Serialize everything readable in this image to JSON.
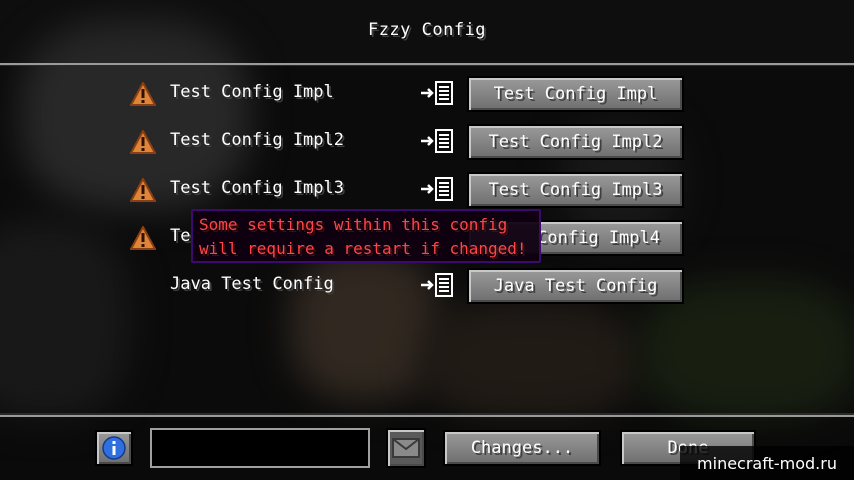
{
  "title": "Fzzy Config",
  "configs": [
    {
      "label": "Test Config Impl",
      "button": "Test Config Impl",
      "warning": true
    },
    {
      "label": "Test Config Impl2",
      "button": "Test Config Impl2",
      "warning": true
    },
    {
      "label": "Test Config Impl3",
      "button": "Test Config Impl3",
      "warning": true
    },
    {
      "label": "Te",
      "button": "Config Impl4",
      "warning": true
    },
    {
      "label": "Java Test Config",
      "button": "Java Test Config",
      "warning": false
    }
  ],
  "tooltip": {
    "line1": "Some settings within this config",
    "line2": "will require a restart if changed!"
  },
  "footer": {
    "info_icon": "info-icon",
    "search_value": "",
    "mail_icon": "envelope-icon",
    "changes_label": "Changes...",
    "done_label": "Done"
  },
  "watermark": "minecraft-mod.ru",
  "colors": {
    "warning": "#e0843a",
    "tooltip_text": "#ff4646",
    "tooltip_border": "#3a0a70",
    "info": "#2f6fe0"
  }
}
